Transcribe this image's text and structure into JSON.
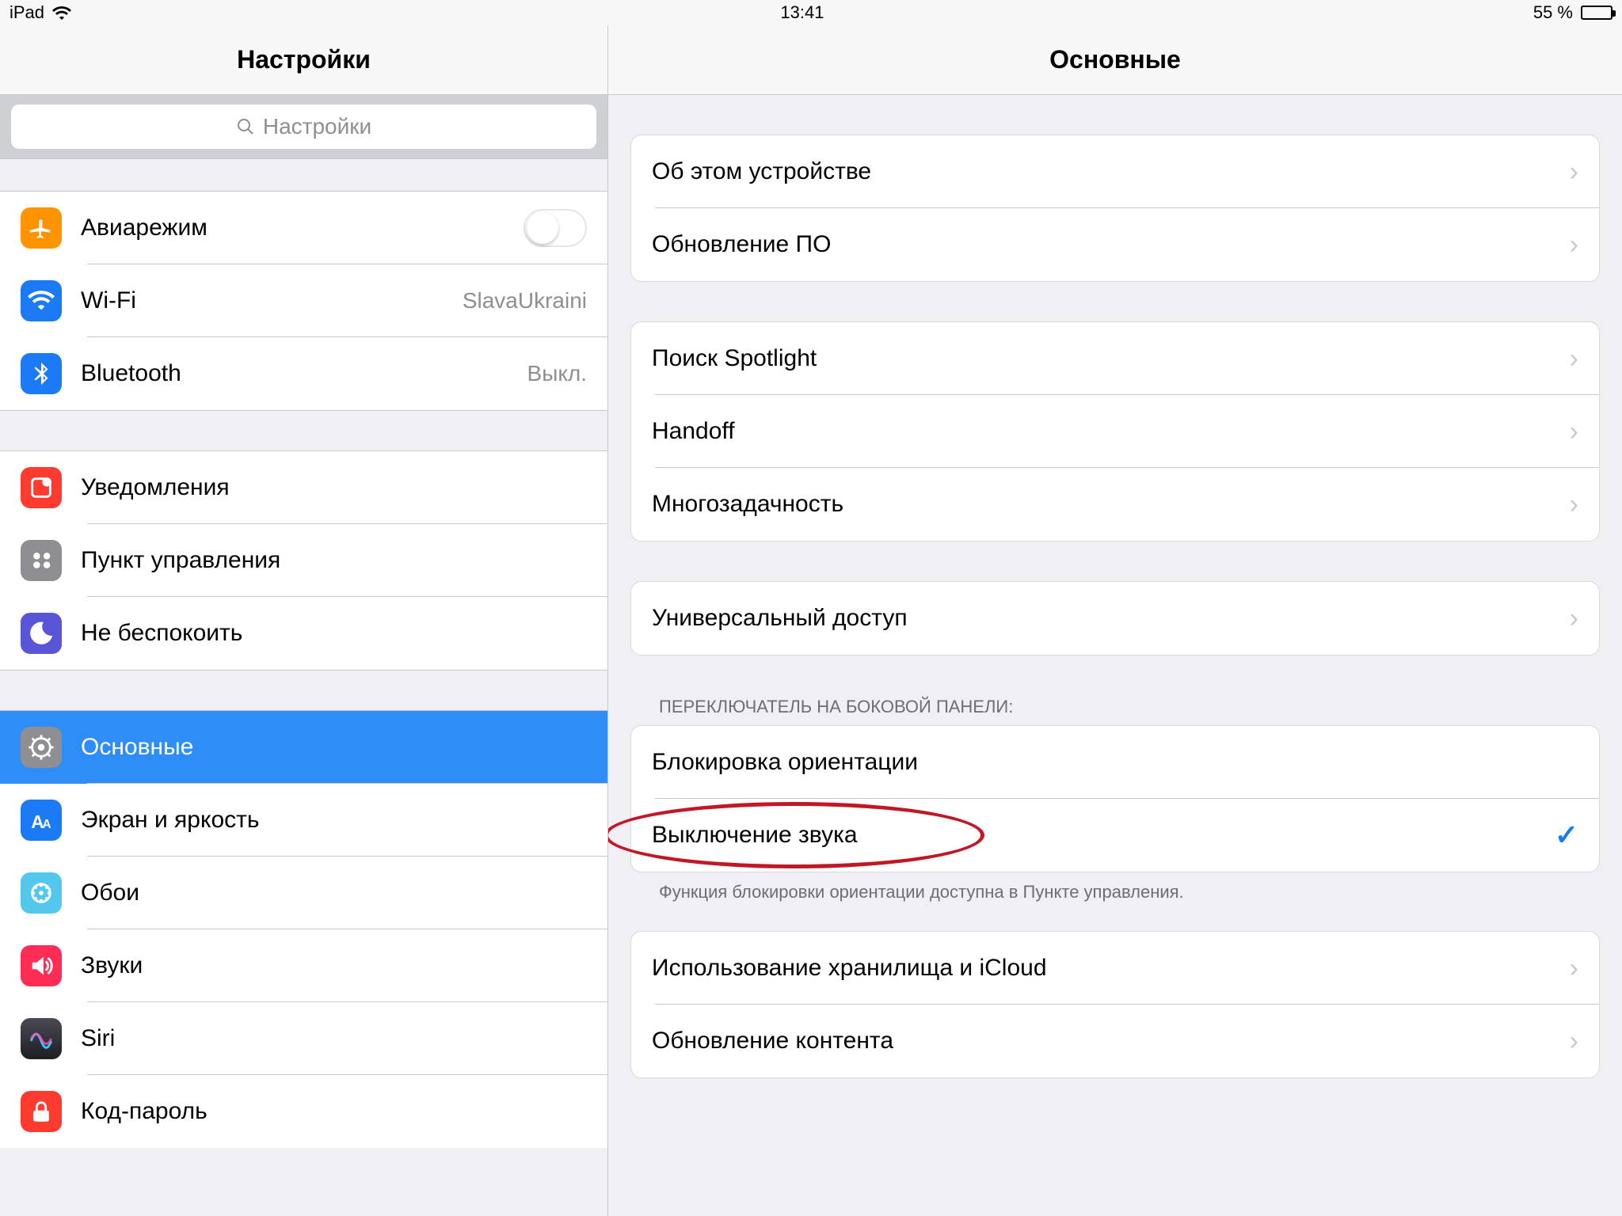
{
  "status": {
    "device": "iPad",
    "time": "13:41",
    "battery_text": "55 %",
    "battery_pct": 55
  },
  "sidebar": {
    "title": "Настройки",
    "search_placeholder": "Настройки",
    "groups": [
      {
        "rows": [
          {
            "id": "airplane",
            "label": "Авиарежим",
            "type": "toggle",
            "icon": "airplane-icon",
            "icon_bg": "#ff9300",
            "toggle_on": false
          },
          {
            "id": "wifi",
            "label": "Wi-Fi",
            "type": "value",
            "value": "SlavaUkraini",
            "icon": "wifi-icon",
            "icon_bg": "#1b7af5"
          },
          {
            "id": "bluetooth",
            "label": "Bluetooth",
            "type": "value",
            "value": "Выкл.",
            "icon": "bluetooth-icon",
            "icon_bg": "#1b7af5"
          }
        ]
      },
      {
        "rows": [
          {
            "id": "notifications",
            "label": "Уведомления",
            "type": "plain",
            "icon": "notifications-icon",
            "icon_bg": "#ff3b30"
          },
          {
            "id": "control-center",
            "label": "Пункт управления",
            "type": "plain",
            "icon": "control-center-icon",
            "icon_bg": "#8e8e93"
          },
          {
            "id": "dnd",
            "label": "Не беспокоить",
            "type": "plain",
            "icon": "moon-icon",
            "icon_bg": "#5856d6"
          }
        ]
      },
      {
        "rows": [
          {
            "id": "general",
            "label": "Основные",
            "type": "plain",
            "icon": "gear-icon",
            "icon_bg": "#8e8e93",
            "selected": true
          },
          {
            "id": "display",
            "label": "Экран и яркость",
            "type": "plain",
            "icon": "text-size-icon",
            "icon_bg": "#1b7af5"
          },
          {
            "id": "wallpaper",
            "label": "Обои",
            "type": "plain",
            "icon": "wallpaper-icon",
            "icon_bg": "#54c7ec"
          },
          {
            "id": "sounds",
            "label": "Звуки",
            "type": "plain",
            "icon": "speaker-icon",
            "icon_bg": "#ff2d55"
          },
          {
            "id": "siri",
            "label": "Siri",
            "type": "plain",
            "icon": "siri-icon",
            "icon_bg": "#222"
          },
          {
            "id": "passcode",
            "label": "Код-пароль",
            "type": "plain",
            "icon": "lock-icon",
            "icon_bg": "#ff3b30"
          }
        ]
      }
    ]
  },
  "detail": {
    "title": "Основные",
    "sections": [
      {
        "rows": [
          {
            "id": "about",
            "label": "Об этом устройстве",
            "chevron": true
          },
          {
            "id": "software-update",
            "label": "Обновление ПО",
            "chevron": true
          }
        ]
      },
      {
        "rows": [
          {
            "id": "spotlight",
            "label": "Поиск Spotlight",
            "chevron": true
          },
          {
            "id": "handoff",
            "label": "Handoff",
            "chevron": true
          },
          {
            "id": "multitasking",
            "label": "Многозадачность",
            "chevron": true
          }
        ]
      },
      {
        "rows": [
          {
            "id": "accessibility",
            "label": "Универсальный доступ",
            "chevron": true
          }
        ]
      },
      {
        "header": "ПЕРЕКЛЮЧАТЕЛЬ НА БОКОВОЙ ПАНЕЛИ:",
        "rows": [
          {
            "id": "lock-rotation",
            "label": "Блокировка ориентации",
            "check": false
          },
          {
            "id": "mute",
            "label": "Выключение звука",
            "check": true,
            "annotated": true
          }
        ],
        "footer": "Функция блокировки ориентации доступна в Пункте управления."
      },
      {
        "rows": [
          {
            "id": "storage-icloud",
            "label": "Использование хранилища и iCloud",
            "chevron": true
          },
          {
            "id": "background-refresh",
            "label": "Обновление контента",
            "chevron": true
          }
        ]
      }
    ]
  }
}
